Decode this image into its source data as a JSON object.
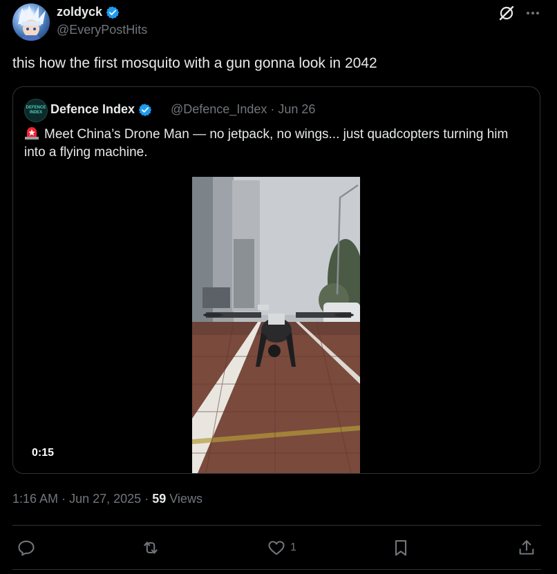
{
  "author": {
    "display_name": "zoldyck",
    "handle": "@EveryPostHits"
  },
  "tweet": {
    "text": "this how the first mosquito with a gun gonna look in 2042",
    "time": "1:16 AM",
    "date": "Jun 27, 2025",
    "views_count": "59",
    "views_label": "Views",
    "sep": "·"
  },
  "quote": {
    "avatar_text": "DEFENCE INDEX",
    "display_name": "Defence Index",
    "handle": "@Defence_Index",
    "date": "Jun 26",
    "sep": "·",
    "text": "Meet China’s Drone Man — no jetpack, no wings... just quadcopters turning him into a flying machine.",
    "video_duration": "0:15"
  },
  "actions": {
    "reply_count": "",
    "repost_count": "",
    "like_count": "1"
  },
  "colors": {
    "background": "#000000",
    "text": "#e7e9ea",
    "secondary": "#71767b",
    "border": "#2f3336",
    "verified": "#1d9bf0",
    "alert": "#f4212e"
  },
  "icons": [
    "verified-badge-icon",
    "grok-icon",
    "more-icon",
    "police-light-icon",
    "reply-icon",
    "repost-icon",
    "like-icon",
    "bookmark-icon",
    "share-icon"
  ]
}
